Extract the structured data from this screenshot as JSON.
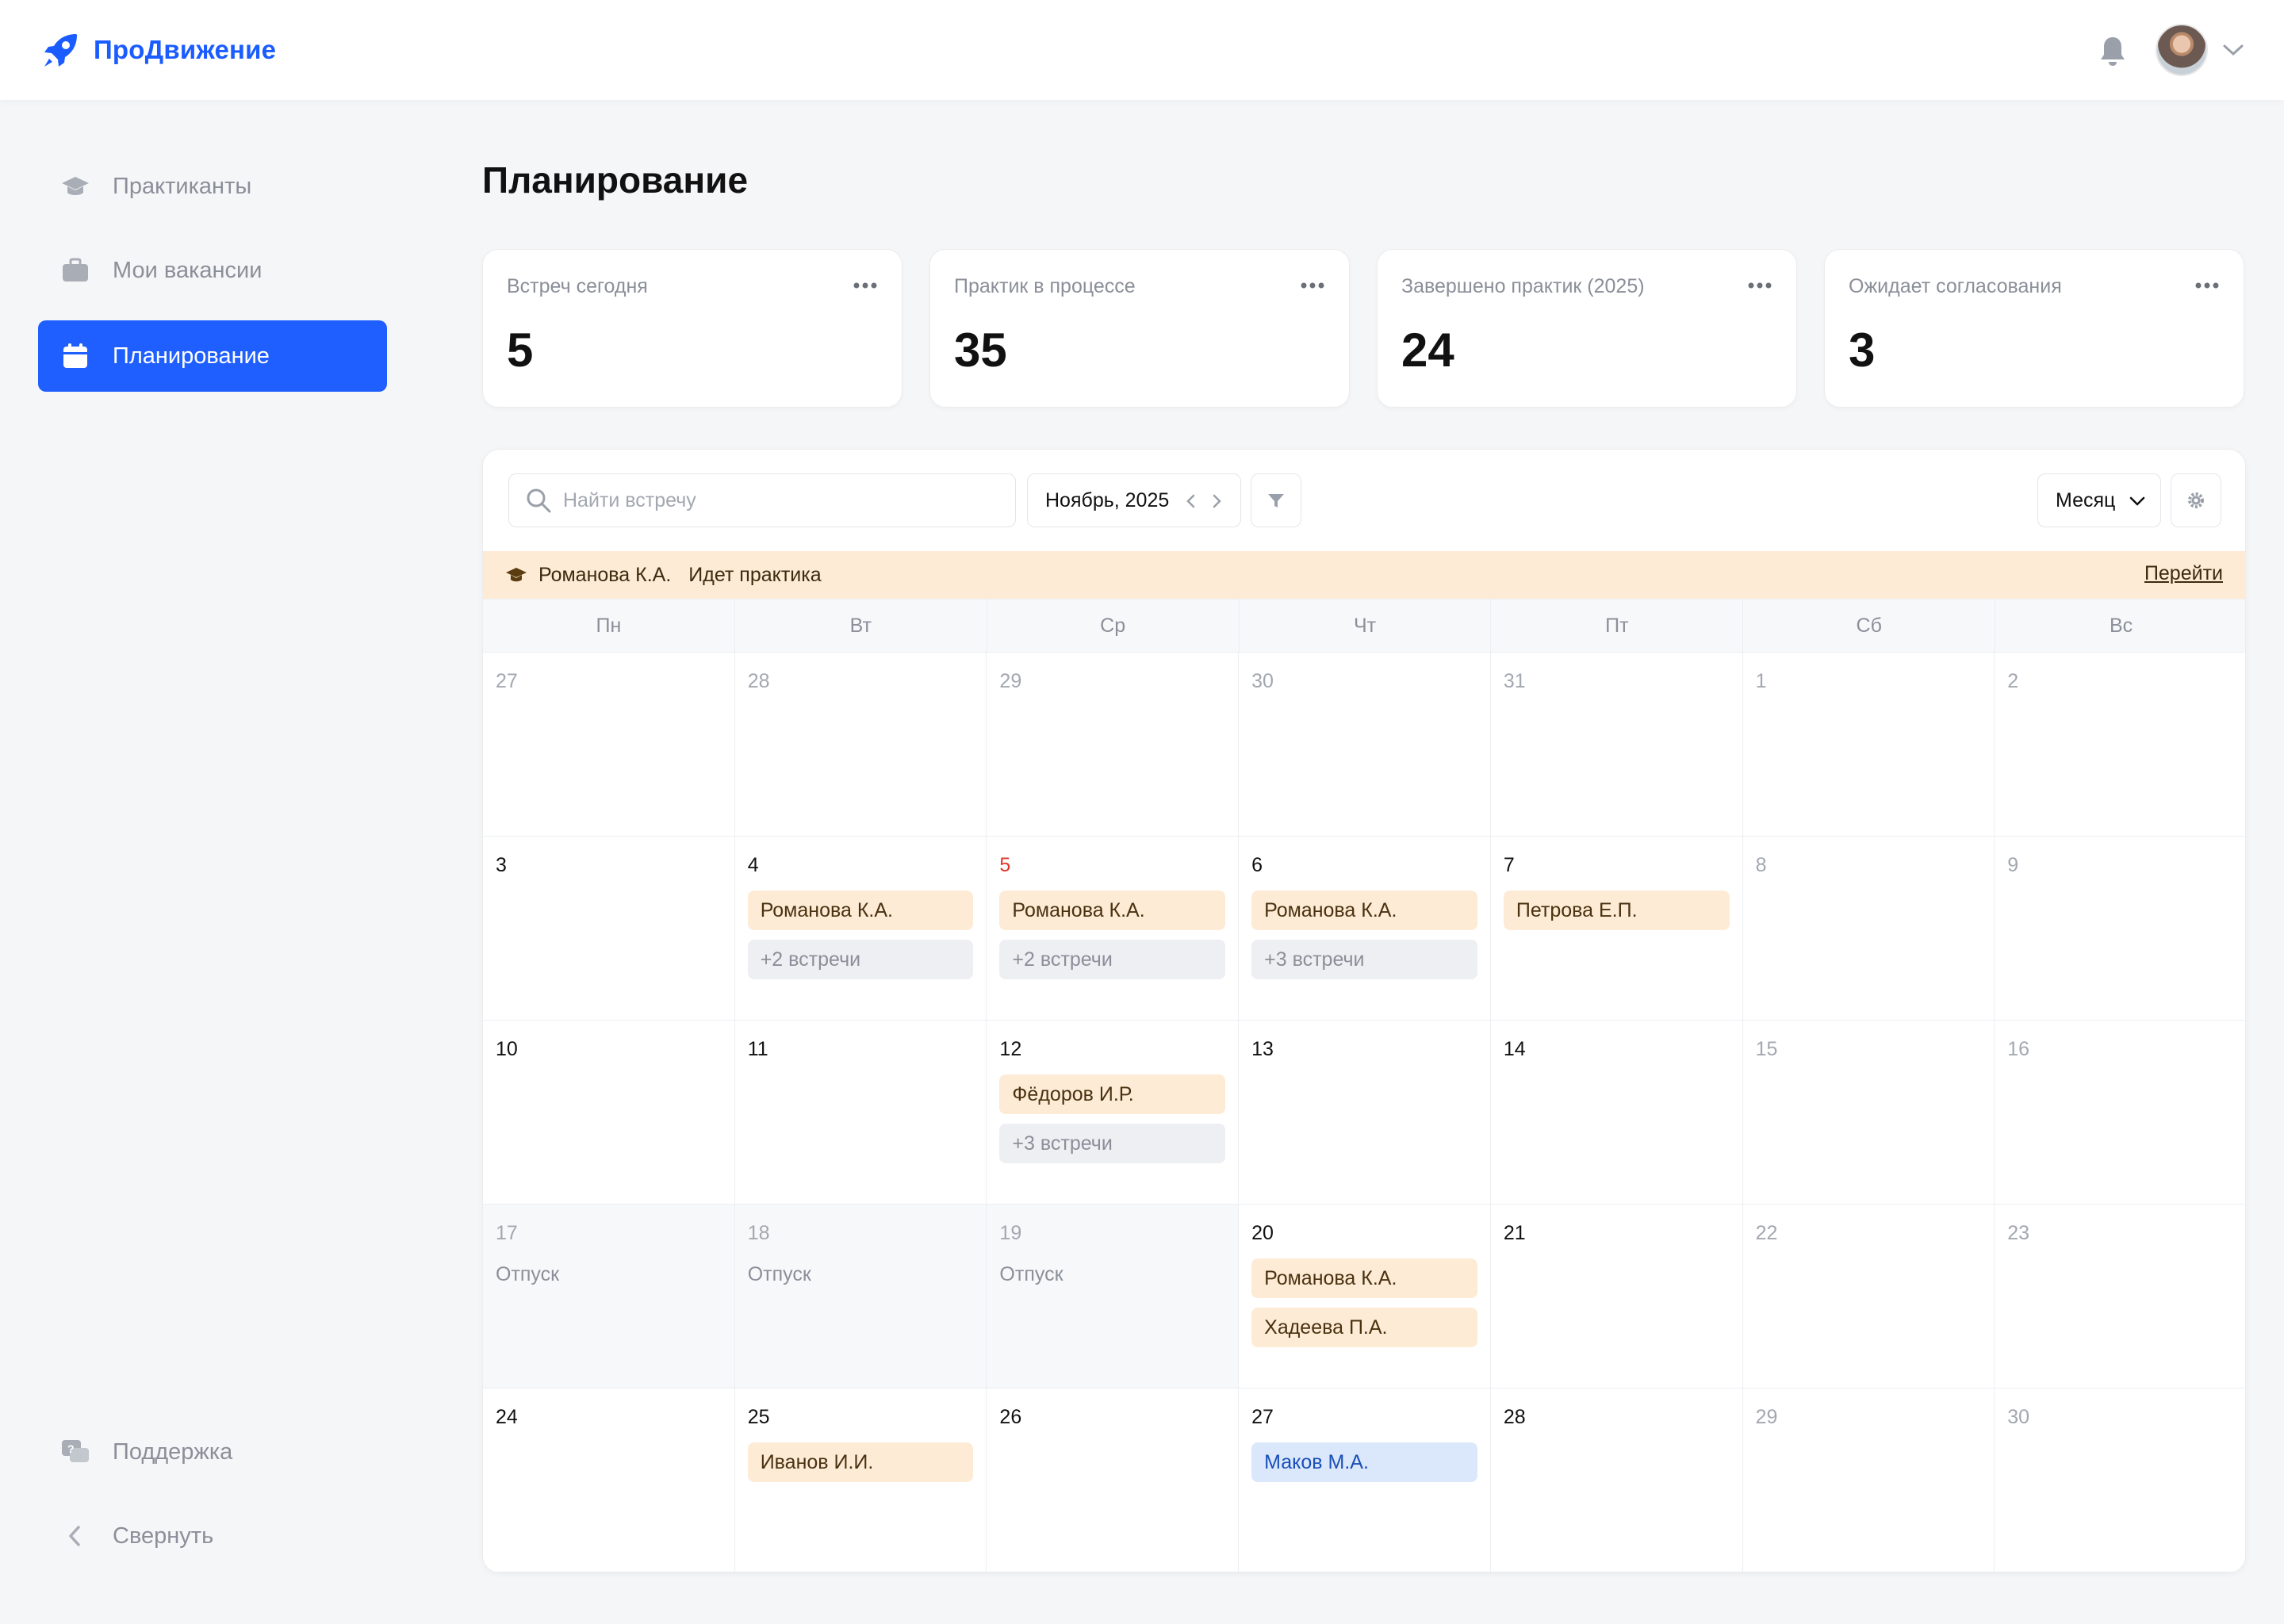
{
  "app": {
    "name": "ПроДвижение",
    "brand_color": "#1a5cff"
  },
  "sidebar": {
    "items": [
      {
        "label": "Практиканты",
        "icon": "graduation-cap-icon"
      },
      {
        "label": "Мои вакансии",
        "icon": "briefcase-icon"
      },
      {
        "label": "Планирование",
        "icon": "calendar-icon",
        "active": true
      }
    ],
    "footer": [
      {
        "label": "Поддержка",
        "icon": "support-chat-icon"
      },
      {
        "label": "Свернуть",
        "icon": "chevron-left-icon"
      }
    ]
  },
  "page": {
    "title": "Планирование"
  },
  "stats": [
    {
      "label": "Встреч сегодня",
      "value": "5"
    },
    {
      "label": "Практик в процессе",
      "value": "35"
    },
    {
      "label": "Завершено практик (2025)",
      "value": "24"
    },
    {
      "label": "Ожидает согласования",
      "value": "3"
    }
  ],
  "toolbar": {
    "search_placeholder": "Найти встречу",
    "month": "Ноябрь, 2025",
    "view": "Месяц"
  },
  "banner": {
    "name": "Романова К.А.",
    "status": "Идет практика",
    "link": "Перейти"
  },
  "weekdays": [
    "Пн",
    "Вт",
    "Ср",
    "Чт",
    "Пт",
    "Сб",
    "Вс"
  ],
  "days": [
    {
      "d": "27"
    },
    {
      "d": "28"
    },
    {
      "d": "29"
    },
    {
      "d": "30"
    },
    {
      "d": "31"
    },
    {
      "d": "1"
    },
    {
      "d": "2"
    },
    {
      "d": "3"
    },
    {
      "d": "4",
      "events": [
        {
          "text": "Романова К.А.",
          "kind": "orange"
        },
        {
          "text": "+2 встречи",
          "kind": "more"
        }
      ]
    },
    {
      "d": "5",
      "today": true,
      "events": [
        {
          "text": "Романова К.А.",
          "kind": "orange"
        },
        {
          "text": "+2 встречи",
          "kind": "more"
        }
      ]
    },
    {
      "d": "6",
      "events": [
        {
          "text": "Романова К.А.",
          "kind": "orange"
        },
        {
          "text": "+3 встречи",
          "kind": "more"
        }
      ]
    },
    {
      "d": "7",
      "events": [
        {
          "text": "Петрова Е.П.",
          "kind": "orange"
        }
      ]
    },
    {
      "d": "8"
    },
    {
      "d": "9"
    },
    {
      "d": "10"
    },
    {
      "d": "11"
    },
    {
      "d": "12",
      "events": [
        {
          "text": "Фёдоров И.Р.",
          "kind": "orange"
        },
        {
          "text": "+3 встречи",
          "kind": "more"
        }
      ]
    },
    {
      "d": "13"
    },
    {
      "d": "14"
    },
    {
      "d": "15"
    },
    {
      "d": "16"
    },
    {
      "d": "17",
      "note": "Отпуск"
    },
    {
      "d": "18",
      "note": "Отпуск"
    },
    {
      "d": "19",
      "note": "Отпуск"
    },
    {
      "d": "20",
      "events": [
        {
          "text": "Романова К.А.",
          "kind": "orange"
        },
        {
          "text": "Хадеева П.А.",
          "kind": "orange"
        }
      ]
    },
    {
      "d": "21"
    },
    {
      "d": "22"
    },
    {
      "d": "23"
    },
    {
      "d": "24"
    },
    {
      "d": "25",
      "events": [
        {
          "text": "Иванов И.И.",
          "kind": "orange"
        }
      ]
    },
    {
      "d": "26"
    },
    {
      "d": "27",
      "events": [
        {
          "text": "Маков М.А.",
          "kind": "blue"
        }
      ]
    },
    {
      "d": "28"
    },
    {
      "d": "29"
    },
    {
      "d": "30"
    }
  ]
}
